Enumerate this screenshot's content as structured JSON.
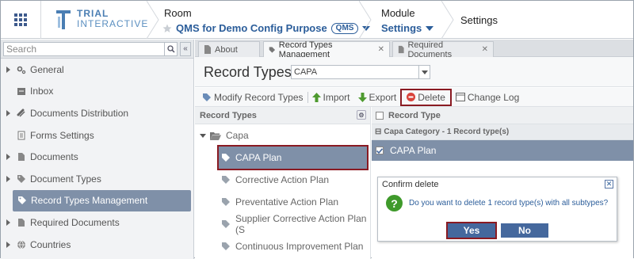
{
  "header": {
    "logo_line1": "TRIAL",
    "logo_line2": "INTERACTIVE",
    "room_label": "Room",
    "room_name": "QMS for Demo Config Purpose",
    "room_badge": "QMS",
    "module_label": "Module",
    "module_name": "Settings",
    "page_title": "Settings"
  },
  "sidebar": {
    "search_placeholder": "Search",
    "items": [
      {
        "label": "General",
        "icon": "gears-icon",
        "has_arrow": true
      },
      {
        "label": "Inbox",
        "icon": "inbox-icon",
        "has_arrow": false
      },
      {
        "label": "Documents Distribution",
        "icon": "link-icon",
        "has_arrow": true
      },
      {
        "label": "Forms Settings",
        "icon": "form-icon",
        "has_arrow": false
      },
      {
        "label": "Documents",
        "icon": "document-icon",
        "has_arrow": true
      },
      {
        "label": "Document Types",
        "icon": "tag-icon",
        "has_arrow": true
      },
      {
        "label": "Record Types Management",
        "icon": "tag-icon",
        "has_arrow": false,
        "active": true
      },
      {
        "label": "Required Documents",
        "icon": "document-icon",
        "has_arrow": true
      },
      {
        "label": "Countries",
        "icon": "globe-icon",
        "has_arrow": true
      }
    ]
  },
  "tabs": [
    {
      "label": "About",
      "active": false
    },
    {
      "label": "Record Types Management",
      "active": true
    },
    {
      "label": "Required Documents",
      "active": false
    }
  ],
  "main": {
    "title": "Record Types",
    "category_select": "CAPA"
  },
  "toolbar": {
    "modify": "Modify Record Types",
    "import": "Import",
    "export": "Export",
    "delete": "Delete",
    "changelog": "Change Log"
  },
  "tree": {
    "header": "Record Types",
    "folder": "Capa",
    "items": [
      "CAPA Plan",
      "Corrective Action Plan",
      "Preventative Action Plan",
      "Supplier Corrective Action Plan (S",
      "Continuous Improvement Plan"
    ]
  },
  "grid": {
    "header": "Record Type",
    "group": "Capa Category - 1 Record type(s)",
    "row": "CAPA Plan"
  },
  "modal": {
    "title": "Confirm delete",
    "message": "Do you want to delete 1 record type(s) with all subtypes?",
    "yes": "Yes",
    "no": "No"
  },
  "colors": {
    "accent": "#2b5d9a",
    "selection": "#7f90a8",
    "highlight_border": "#8a1a22"
  }
}
